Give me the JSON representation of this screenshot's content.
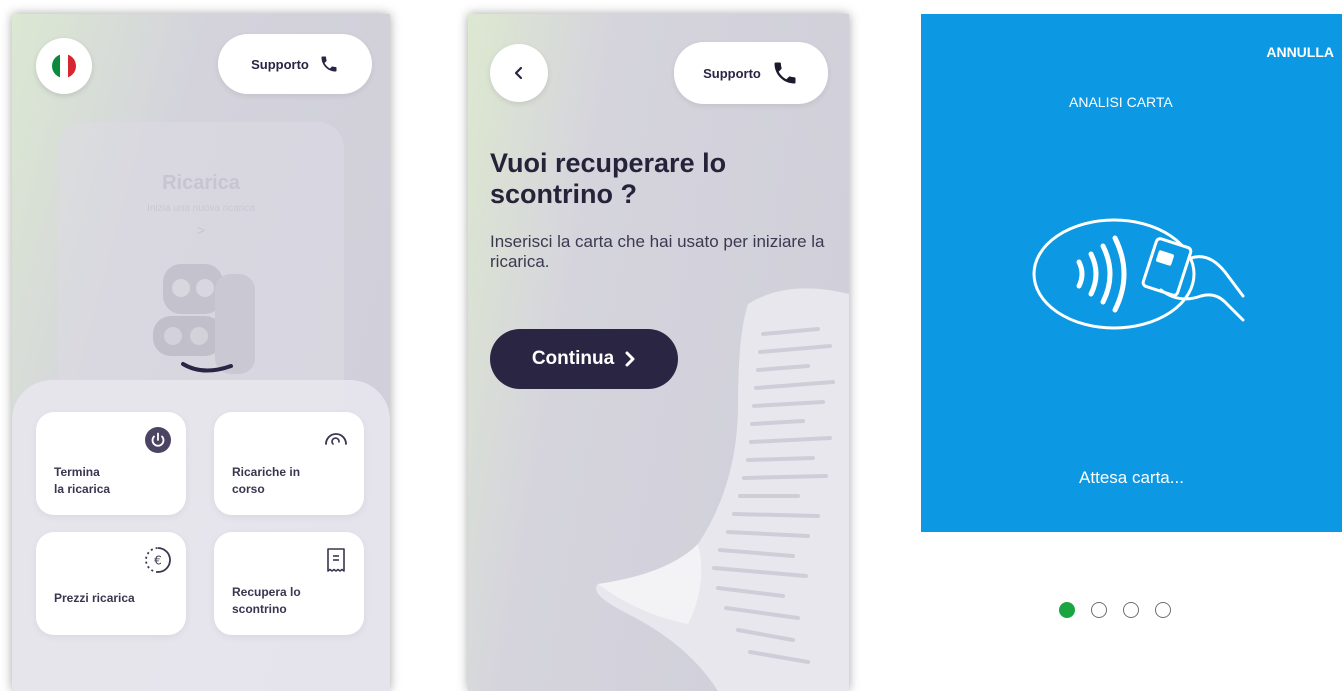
{
  "screen1": {
    "support_label": "Supporto",
    "flag_colors": [
      "#0a8a3c",
      "#ffffff",
      "#d6262f"
    ],
    "ghost": {
      "title": "Ricarica",
      "subtitle": "Inizia una nuova ricarica",
      "chevron": ">"
    },
    "tiles": [
      {
        "label": "Termina\nla ricarica",
        "icon": "power-icon"
      },
      {
        "label": "Ricariche in\ncorso",
        "icon": "charging-progress-icon"
      },
      {
        "label": "Prezzi ricarica",
        "icon": "euro-icon"
      },
      {
        "label": "Recupera lo\nscontrino",
        "icon": "receipt-icon"
      }
    ]
  },
  "screen2": {
    "support_label": "Supporto",
    "back_icon": "chevron-left-icon",
    "title": "Vuoi recuperare lo scontrino ?",
    "subtitle": "Inserisci la carta che hai usato per iniziare la ricarica.",
    "continue_label": "Continua"
  },
  "screen3": {
    "cancel_label": "ANNULLA",
    "header_label": "ANALISI CARTA",
    "status_label": "Attesa carta...",
    "accent_color": "#0c98e2",
    "steps": {
      "total": 4,
      "active": 1
    }
  }
}
